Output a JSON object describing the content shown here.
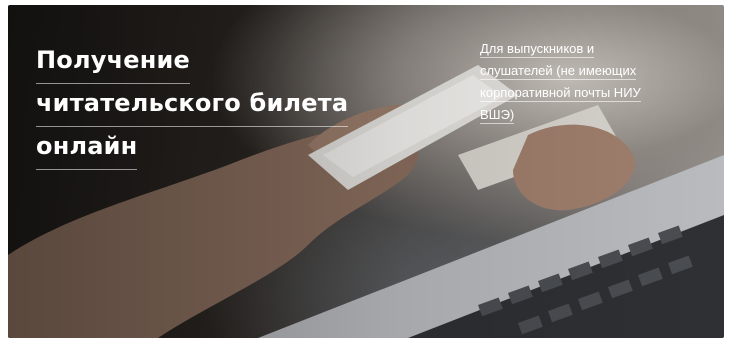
{
  "banner": {
    "title_lines": [
      "Получение",
      "читательского билета",
      "онлайн"
    ],
    "subtitle_lines": [
      "Для выпускников и",
      "слушателей (не имеющих",
      "корпоративной почты НИУ",
      "ВШЭ)"
    ],
    "image": "hands-holding-phone-over-laptop"
  }
}
